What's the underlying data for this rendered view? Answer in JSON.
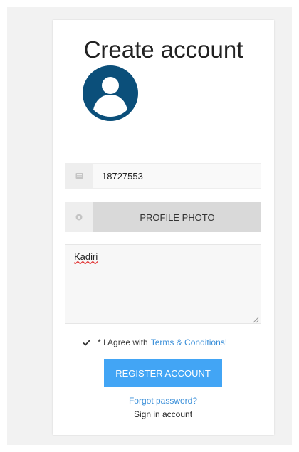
{
  "form": {
    "title": "Create account",
    "username_value": "18727553",
    "profile_photo_label": "PROFILE PHOTO",
    "bio_value": "Kadiri",
    "agree_prefix": "* I Agree with",
    "terms_link": "Terms & Conditions!",
    "agree_checked": true,
    "register_label": "REGISTER ACCOUNT",
    "forgot_label": "Forgot password?",
    "signin_label": "Sign in account"
  },
  "icons": {
    "avatar": "user-avatar-icon",
    "username": "id-card-icon",
    "photo": "camera-icon",
    "check": "check-icon"
  },
  "colors": {
    "avatar": "#0b4f7a",
    "link": "#3a8fd9",
    "primary_button": "#42a5f5",
    "photo_button": "#d9d9d9",
    "backdrop": "#f2f2f2"
  }
}
